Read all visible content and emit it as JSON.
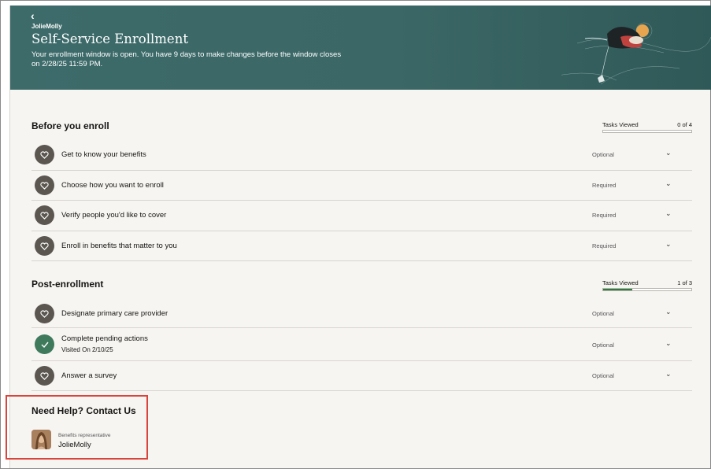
{
  "header": {
    "back_icon": "‹",
    "brand": "JolieMolly",
    "title": "Self-Service Enrollment",
    "subtitle": "Your enrollment window is open. You have 9 days to make changes before the window closes on 2/28/25 11:59 PM."
  },
  "before_enroll": {
    "title": "Before you enroll",
    "progress": {
      "label": "Tasks Viewed",
      "count": "0 of 4",
      "fraction": 0.0
    },
    "tasks": [
      {
        "name": "Get to know your benefits",
        "status": "Optional"
      },
      {
        "name": "Choose how you want to enroll",
        "status": "Required"
      },
      {
        "name": "Verify people you'd like to cover",
        "status": "Required"
      },
      {
        "name": "Enroll in benefits that matter to you",
        "status": "Required"
      }
    ]
  },
  "post_enroll": {
    "title": "Post-enrollment",
    "progress": {
      "label": "Tasks Viewed",
      "count": "1 of 3",
      "fraction": 0.333
    },
    "tasks": [
      {
        "name": "Designate primary care provider",
        "status": "Optional"
      },
      {
        "name": "Complete pending actions",
        "sub": "Visited On 2/10/25",
        "status": "Optional"
      },
      {
        "name": "Answer a survey",
        "status": "Optional"
      }
    ]
  },
  "help": {
    "title": "Need Help? Contact Us",
    "role": "Benefits representative",
    "name": "JolieMolly"
  },
  "icons": {
    "task": "heart-icon",
    "done": "check-icon",
    "expand": "chevron-down-icon"
  },
  "colors": {
    "banner": "#3d6b6a",
    "progress_fill": "#2a7d3a",
    "highlight": "#d9453d",
    "task_circle": "#5b5750",
    "task_done": "#3e7a5b"
  }
}
